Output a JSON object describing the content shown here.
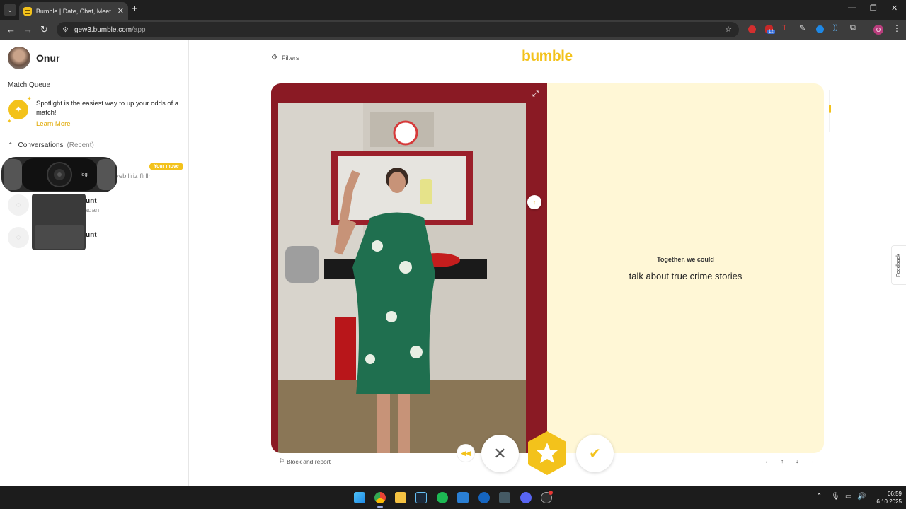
{
  "browser": {
    "tab_title": "Bumble | Date, Chat, Meet New",
    "url_host": "gew3.bumble.com",
    "url_path": "/app",
    "ext_badge": "12",
    "profile_initial": "O"
  },
  "sidebar": {
    "user_name": "Onur",
    "match_queue_title": "Match Queue",
    "spotlight_text": "Spotlight is the easiest way to up your odds of a match!",
    "learn_more": "Learn More",
    "conversations_title": "Conversations",
    "conversations_filter": "(Recent)",
    "conversations": [
      {
        "name": "",
        "snippet": "iyebiliriz flrllr",
        "badge": "Your move"
      },
      {
        "name": "unt",
        "snippet": "adan",
        "badge": ""
      },
      {
        "name": "unt",
        "snippet": "",
        "badge": ""
      }
    ],
    "webcam_brand": "logi"
  },
  "main": {
    "filters_label": "Filters",
    "logo": "bumble",
    "prompt_question": "Together, we could",
    "prompt_answer": "talk about true crime stories",
    "block_report": "Block and report",
    "keyboard_hints": [
      "←",
      "↑",
      "↓",
      "→"
    ],
    "feedback_label": "Feedback"
  },
  "taskbar": {
    "time": "06:59",
    "date": "6.10.2025"
  },
  "colors": {
    "brand_yellow": "#f3c21b",
    "prompt_bg": "#fff7d6",
    "chrome_dark": "#1f1f1f"
  }
}
